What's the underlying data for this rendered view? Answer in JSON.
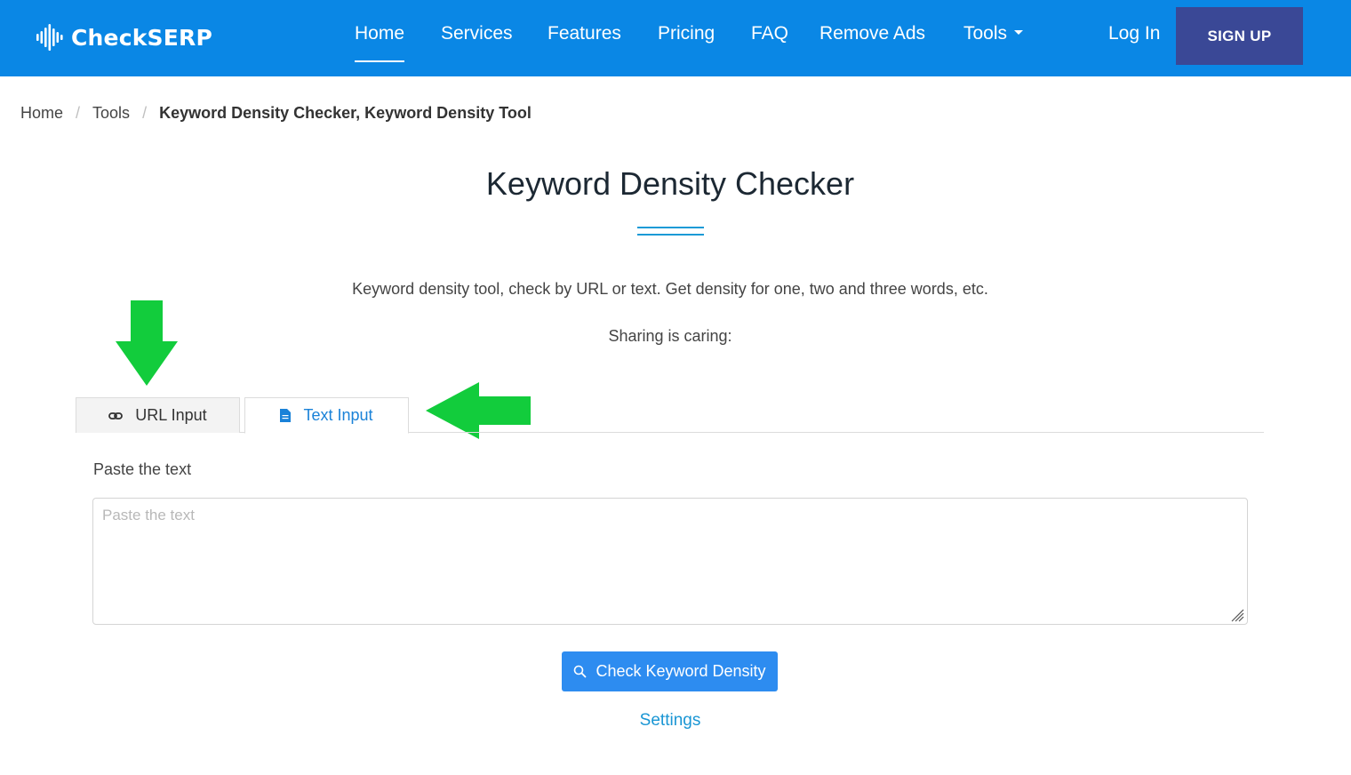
{
  "brand": {
    "name": "CheckSERP"
  },
  "nav": {
    "items": [
      {
        "label": "Home",
        "active": true
      },
      {
        "label": "Services"
      },
      {
        "label": "Features"
      },
      {
        "label": "Pricing"
      },
      {
        "label": "FAQ"
      },
      {
        "label": "Remove Ads"
      },
      {
        "label": "Tools",
        "dropdown": true
      }
    ],
    "login": "Log In",
    "signup": "SIGN UP"
  },
  "breadcrumb": {
    "items": [
      "Home",
      "Tools"
    ],
    "current": "Keyword Density Checker, Keyword Density Tool"
  },
  "page": {
    "title": "Keyword Density Checker",
    "description": "Keyword density tool, check by URL or text. Get density for one, two and three words, etc.",
    "sharing": "Sharing is caring:"
  },
  "tabs": [
    {
      "label": "URL Input",
      "icon": "link-icon",
      "active": false
    },
    {
      "label": "Text Input",
      "icon": "document-icon",
      "active": true
    }
  ],
  "form": {
    "label": "Paste the text",
    "placeholder": "Paste the text",
    "value": "",
    "submit_label": "Check Keyword Density",
    "settings_label": "Settings"
  },
  "colors": {
    "navbar": "#0a87e5",
    "signup": "#3a4896",
    "primary_button": "#2d8cf0",
    "active_tab_text": "#1a82d8",
    "annotation_arrow": "#12cc3c"
  }
}
